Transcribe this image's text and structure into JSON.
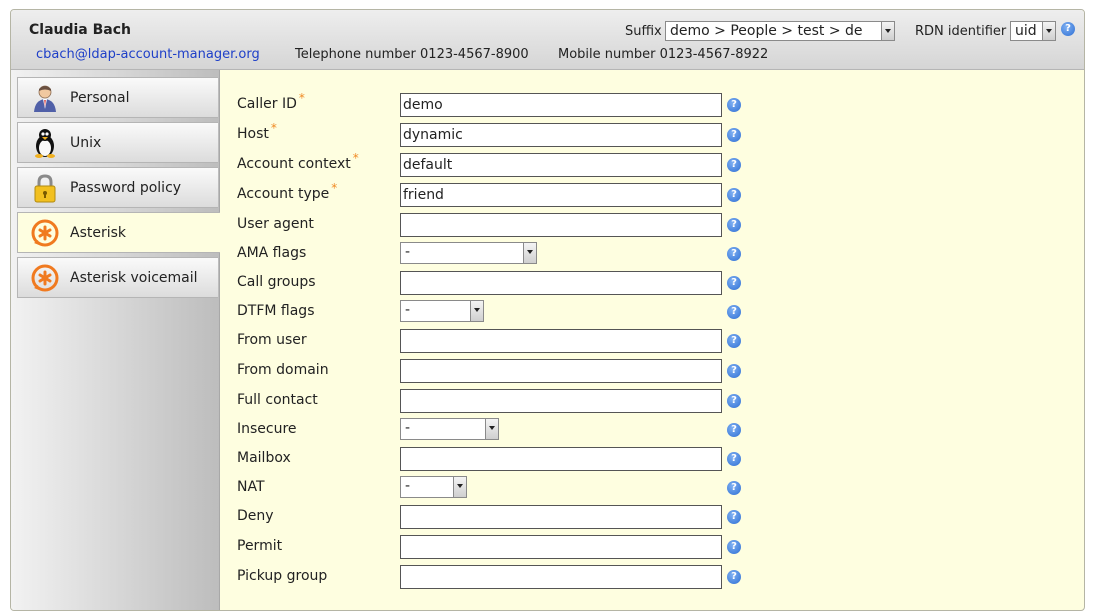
{
  "header": {
    "user_name": "Claudia Bach",
    "email": "cbach@ldap-account-manager.org",
    "telephone": "Telephone number 0123-4567-8900",
    "mobile": "Mobile number 0123-4567-8922",
    "suffix_label": "Suffix",
    "suffix_value": "demo > People > test > de",
    "rdn_label": "RDN identifier",
    "rdn_value": "uid"
  },
  "tabs": [
    {
      "label": "Personal",
      "icon": "personal-icon",
      "active": false
    },
    {
      "label": "Unix",
      "icon": "tux-icon",
      "active": false
    },
    {
      "label": "Password policy",
      "icon": "padlock-icon",
      "active": false
    },
    {
      "label": "Asterisk",
      "icon": "asterisk-icon",
      "active": true
    },
    {
      "label": "Asterisk voicemail",
      "icon": "asterisk-icon",
      "active": false
    }
  ],
  "form": {
    "required_marker": "*",
    "fields": [
      {
        "label": "Caller ID",
        "required": true,
        "type": "text",
        "value": "demo"
      },
      {
        "label": "Host",
        "required": true,
        "type": "text",
        "value": "dynamic"
      },
      {
        "label": "Account context",
        "required": true,
        "type": "text",
        "value": "default"
      },
      {
        "label": "Account type",
        "required": true,
        "type": "text",
        "value": "friend"
      },
      {
        "label": "User agent",
        "required": false,
        "type": "text",
        "value": ""
      },
      {
        "label": "AMA flags",
        "required": false,
        "type": "select",
        "value": "-"
      },
      {
        "label": "Call groups",
        "required": false,
        "type": "text",
        "value": ""
      },
      {
        "label": "DTFM flags",
        "required": false,
        "type": "select",
        "value": "-"
      },
      {
        "label": "From user",
        "required": false,
        "type": "text",
        "value": ""
      },
      {
        "label": "From domain",
        "required": false,
        "type": "text",
        "value": ""
      },
      {
        "label": "Full contact",
        "required": false,
        "type": "text",
        "value": ""
      },
      {
        "label": "Insecure",
        "required": false,
        "type": "select",
        "value": "-"
      },
      {
        "label": "Mailbox",
        "required": false,
        "type": "text",
        "value": ""
      },
      {
        "label": "NAT",
        "required": false,
        "type": "select",
        "value": "-"
      },
      {
        "label": "Deny",
        "required": false,
        "type": "text",
        "value": ""
      },
      {
        "label": "Permit",
        "required": false,
        "type": "text",
        "value": ""
      },
      {
        "label": "Pickup group",
        "required": false,
        "type": "text",
        "value": ""
      }
    ]
  },
  "icons": {
    "help": "help-icon",
    "help_glyph": "?"
  },
  "colors": {
    "background": "#fefee0",
    "link": "#1e3fc8",
    "required": "#f08a24",
    "help": "#2e6fd4"
  }
}
